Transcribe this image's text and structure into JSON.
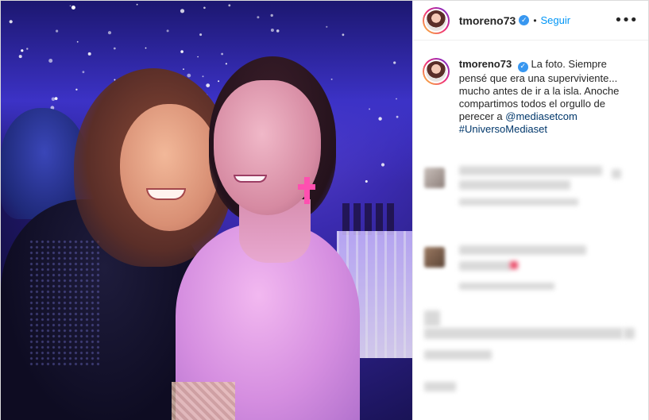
{
  "header": {
    "username": "tmoreno73",
    "verified_icon": "verified-badge-icon",
    "separator": "•",
    "follow_label": "Seguir",
    "more_icon": "more-options-icon",
    "more_glyph": "•••"
  },
  "caption": {
    "username": "tmoreno73",
    "text_before_link": "La foto. Siempre pensé que era una superviviente... mucho antes de ir a la isla. Anoche compartimos todos el orgullo de perecer a",
    "mention": "@mediasetcom",
    "hashtag": "#UniversoMediaset"
  },
  "colors": {
    "link_blue": "#0095f6",
    "verified_blue": "#3897f0",
    "mention_color": "#00376b",
    "earring_pink": "#ff4fb0"
  }
}
